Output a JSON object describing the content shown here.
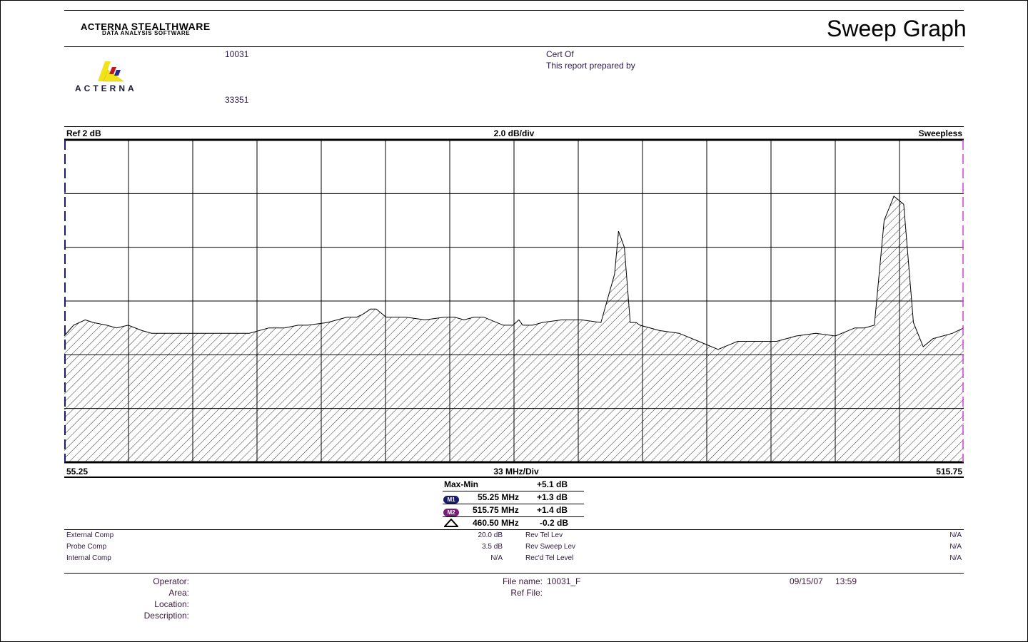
{
  "header": {
    "brand_acterna": "ACTERNA",
    "brand_stealthware": "STEALTHWARE",
    "brand_sub": "DATA ANALYSIS SOFTWARE",
    "report_title": "Sweep Graph",
    "logo_text": "ACTERNA",
    "node_id": "10031",
    "zip": "33351",
    "cert_of": "Cert Of",
    "prepared_by": "This report prepared by"
  },
  "chart_data": {
    "type": "area",
    "ref_label": "Ref 2 dB",
    "scale_label": "2.0 dB/div",
    "mode_label": "Sweepless",
    "x_start_label": "55.25",
    "x_div_label": "33 MHz/Div",
    "x_end_label": "515.75",
    "x_range": [
      55.25,
      515.75
    ],
    "y_range": [
      -10,
      2
    ],
    "grid": true,
    "x_divisions": 14,
    "y_divisions": 6,
    "series": [
      {
        "x": [
          55.25,
          60,
          66,
          70,
          77,
          82,
          88,
          95,
          100,
          115,
          130,
          150,
          160,
          168,
          175,
          180,
          190,
          200,
          205,
          208,
          212,
          215,
          220,
          230,
          240,
          250,
          255,
          260,
          265,
          270,
          280,
          285,
          288,
          290,
          295,
          300,
          310,
          320,
          330,
          337,
          339,
          342,
          345,
          348,
          350,
          360,
          370,
          380,
          390,
          400,
          410,
          420,
          430,
          440,
          450,
          460,
          465,
          470,
          475,
          480,
          485,
          490,
          495,
          500,
          505,
          510,
          515.75
        ],
        "y": [
          -5.3,
          -4.9,
          -4.7,
          -4.8,
          -4.9,
          -5.0,
          -4.9,
          -5.1,
          -5.2,
          -5.2,
          -5.2,
          -5.2,
          -5.0,
          -5.0,
          -4.9,
          -4.9,
          -4.8,
          -4.6,
          -4.6,
          -4.5,
          -4.3,
          -4.3,
          -4.6,
          -4.6,
          -4.7,
          -4.6,
          -4.6,
          -4.7,
          -4.6,
          -4.6,
          -4.9,
          -4.9,
          -4.7,
          -4.9,
          -4.9,
          -4.8,
          -4.7,
          -4.7,
          -4.8,
          -3.0,
          -1.4,
          -2.0,
          -4.8,
          -4.8,
          -4.9,
          -5.1,
          -5.2,
          -5.5,
          -5.8,
          -5.5,
          -5.5,
          -5.5,
          -5.3,
          -5.2,
          -5.3,
          -5.0,
          -5.0,
          -4.9,
          -1.0,
          -0.1,
          -0.4,
          -4.8,
          -5.7,
          -5.4,
          -5.3,
          -5.2,
          -5.0
        ]
      }
    ]
  },
  "stats": {
    "maxmin_label": "Max-Min",
    "maxmin_value": "+5.1 dB",
    "m1_badge": "M1",
    "m1_freq": "55.25 MHz",
    "m1_value": "+1.3 dB",
    "m2_badge": "M2",
    "m2_freq": "515.75 MHz",
    "m2_value": "+1.4 dB",
    "delta_freq": "460.50 MHz",
    "delta_value": "-0.2 dB",
    "m1_color": "#1a1a6e",
    "m2_color": "#7a1a7a"
  },
  "comp": {
    "external_label": "External Comp",
    "external_value": "20.0 dB",
    "probe_label": "Probe Comp",
    "probe_value": "3.5 dB",
    "internal_label": "Internal Comp",
    "internal_value": "N/A",
    "rev_tel_label": "Rev Tel Lev",
    "rev_tel_value": "N/A",
    "rev_sweep_label": "Rev Sweep Lev",
    "rev_sweep_value": "N/A",
    "recd_tel_label": "Rec'd Tel Level",
    "recd_tel_value": "N/A"
  },
  "footer": {
    "operator_label": "Operator:",
    "area_label": "Area:",
    "location_label": "Location:",
    "description_label": "Description:",
    "filename_label": "File name:",
    "filename_value": "10031_F",
    "reffile_label": "Ref File:",
    "date": "09/15/07",
    "time": "13:59"
  }
}
